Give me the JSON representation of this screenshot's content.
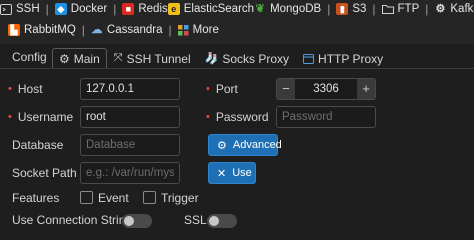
{
  "db_tabs_row1": [
    {
      "label": "SSH",
      "icon": "terminal-icon"
    },
    {
      "label": "Docker",
      "icon": "docker-icon"
    },
    {
      "label": "Redis",
      "icon": "redis-icon"
    },
    {
      "label": "ElasticSearch",
      "icon": "elasticsearch-icon"
    },
    {
      "label": "MongoDB",
      "icon": "mongodb-icon"
    },
    {
      "label": "S3",
      "icon": "s3-icon"
    },
    {
      "label": "FTP",
      "icon": "folder-icon"
    },
    {
      "label": "Kafka",
      "icon": "kafka-icon"
    }
  ],
  "db_tabs_row2": [
    {
      "label": "RabbitMQ",
      "icon": "rabbitmq-icon"
    },
    {
      "label": "Cassandra",
      "icon": "cassandra-icon"
    },
    {
      "label": "More",
      "icon": "grid-icon"
    }
  ],
  "separator": "|",
  "config": {
    "label": "Config",
    "tabs": [
      {
        "label": "Main",
        "icon": "gear-icon",
        "active": true
      },
      {
        "label": "SSH Tunnel",
        "icon": "tunnel-icon",
        "active": false
      },
      {
        "label": "Socks Proxy",
        "icon": "socks-icon",
        "active": false
      },
      {
        "label": "HTTP Proxy",
        "icon": "window-icon",
        "active": false
      }
    ]
  },
  "form": {
    "host_label": "Host",
    "host_value": "127.0.0.1",
    "port_label": "Port",
    "port_value": "3306",
    "port_minus": "−",
    "port_plus": "+",
    "username_label": "Username",
    "username_value": "root",
    "password_label": "Password",
    "password_placeholder": "Password",
    "database_label": "Database",
    "database_placeholder": "Database",
    "advanced_label": "Advanced",
    "socket_label": "Socket Path",
    "socket_placeholder": "e.g.: /var/run/mysqld/m",
    "use_label": "Use",
    "features_label": "Features",
    "event_label": "Event",
    "trigger_label": "Trigger",
    "use_conn_string_label": "Use Connection String",
    "ssl_label": "SSL",
    "required_mark": "•"
  },
  "colors": {
    "accent": "#1e6fb3",
    "required": "#e74c3c",
    "background": "#1e1e1e"
  }
}
